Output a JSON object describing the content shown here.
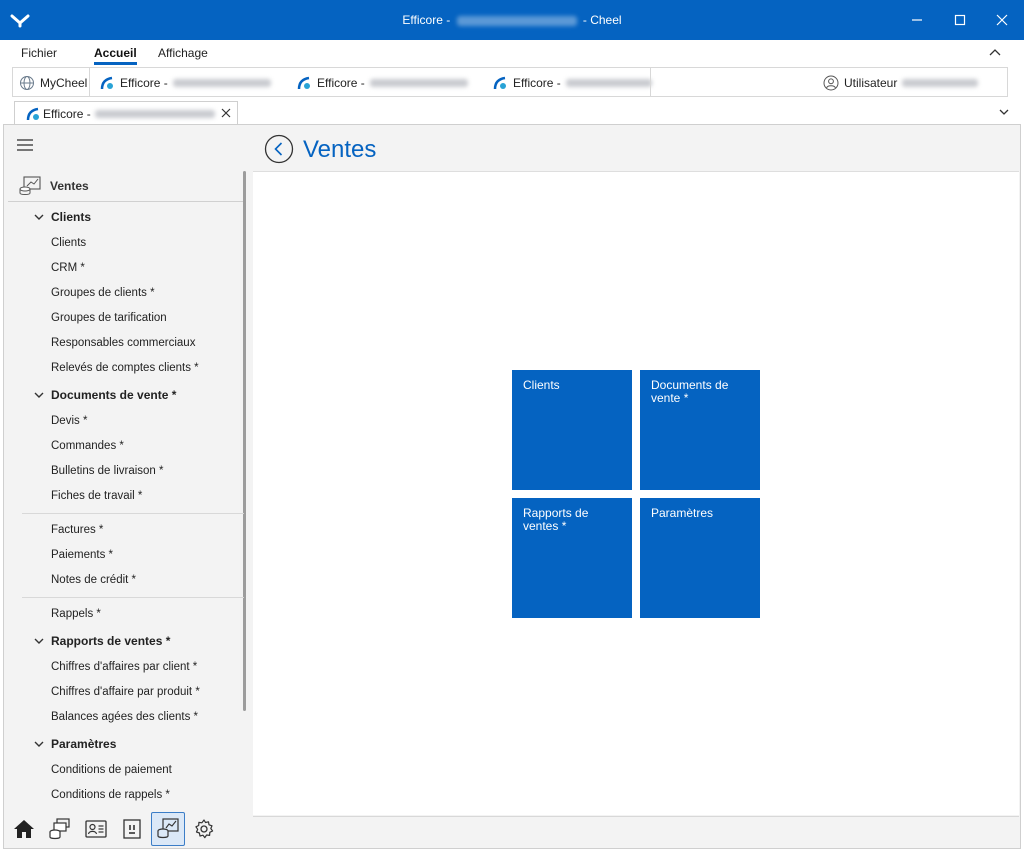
{
  "window": {
    "title_prefix": "Efficore -",
    "title_suffix": "- Cheel",
    "title_blur_text": "B.2 Immobilier sàrl - 2023"
  },
  "ribbon": {
    "tabs": [
      {
        "label": "Fichier"
      },
      {
        "label": "Accueil"
      },
      {
        "label": "Affichage"
      }
    ]
  },
  "quickbar": {
    "mycheel": "MyCheel",
    "items": [
      {
        "label": "Efficore -",
        "blur": "B.2 Immobilier sàrl - 2023"
      },
      {
        "label": "Efficore -",
        "blur": "B.2 Immobilier sàrl - 2024"
      },
      {
        "label": "Efficore -",
        "blur": "FS Fiduciaire - 2023"
      }
    ],
    "user_label": "Utilisateur",
    "user_email": "fiduciaire@exemple.ch"
  },
  "doctab": {
    "label": "Efficore -",
    "blur": "B.2 Immobilier sàrl - 2023"
  },
  "sidebar": {
    "heading": "Ventes",
    "groups": [
      {
        "label": "Clients",
        "items": [
          "Clients",
          "CRM *",
          "Groupes de clients *",
          "Groupes de tarification",
          "Responsables commerciaux",
          "Relevés de comptes clients *"
        ]
      },
      {
        "label": "Documents de vente *",
        "items": [
          "Devis *",
          "Commandes *",
          "Bulletins de livraison *",
          "Fiches de travail *",
          "Factures *",
          "Paiements *",
          "Notes de crédit *",
          "Rappels *"
        ]
      },
      {
        "label": "Rapports de ventes *",
        "items": [
          "Chiffres d'affaires par client *",
          "Chiffres d'affaire par produit *",
          "Balances agées des clients *"
        ]
      },
      {
        "label": "Paramètres",
        "items": [
          "Conditions de paiement",
          "Conditions de rappels *"
        ]
      }
    ]
  },
  "navbar": {
    "icons": [
      "home-icon",
      "finance-icon",
      "contacts-icon",
      "calendar-icon",
      "sales-icon",
      "settings-icon"
    ],
    "active": "sales-icon"
  },
  "main": {
    "title": "Ventes",
    "tiles": [
      "Clients",
      "Documents de vente *",
      "Rapports de ventes *",
      "Paramètres"
    ]
  },
  "colors": {
    "accent": "#0563c1",
    "background": "#f3f3f3"
  }
}
